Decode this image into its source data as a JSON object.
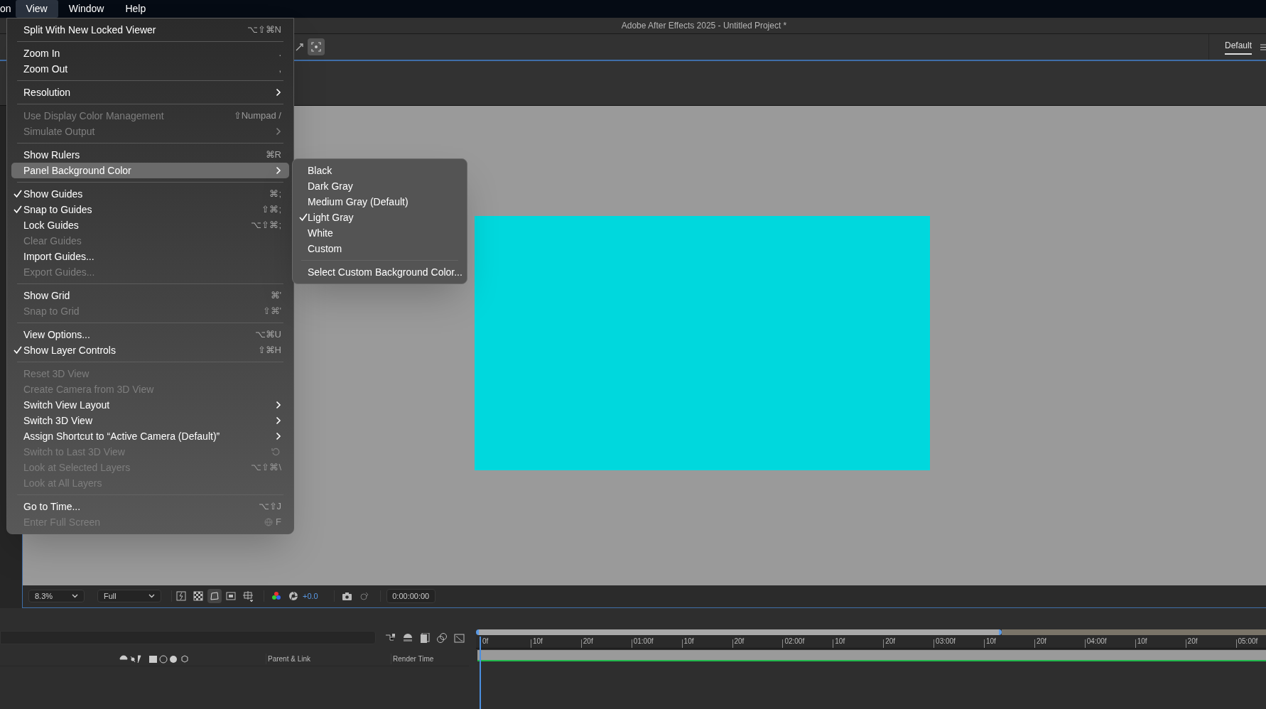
{
  "menu_bar": [
    {
      "label": "on",
      "selected": false
    },
    {
      "label": "View",
      "selected": true
    },
    {
      "label": "Window",
      "selected": false
    },
    {
      "label": "Help",
      "selected": false
    }
  ],
  "window": {
    "title": "Adobe After Effects 2025 - Untitled Project *"
  },
  "workspace": {
    "label": "Default",
    "selected": true
  },
  "view_menu": {
    "groups": [
      [
        {
          "label": "Split With New Locked Viewer",
          "shortcut": "⌥⇧⌘N",
          "checked": false,
          "disabled": false,
          "submenu": false,
          "selected": false
        }
      ],
      [
        {
          "label": "Zoom In",
          "shortcut": ".",
          "checked": false,
          "disabled": false,
          "submenu": false,
          "selected": false
        },
        {
          "label": "Zoom Out",
          "shortcut": ",",
          "checked": false,
          "disabled": false,
          "submenu": false,
          "selected": false
        }
      ],
      [
        {
          "label": "Resolution",
          "checked": false,
          "disabled": false,
          "submenu": true,
          "selected": false
        }
      ],
      [
        {
          "label": "Use Display Color Management",
          "shortcut": "⇧Numpad /",
          "checked": false,
          "disabled": true,
          "submenu": false,
          "selected": false
        },
        {
          "label": "Simulate Output",
          "checked": false,
          "disabled": true,
          "submenu": true,
          "selected": false
        }
      ],
      [
        {
          "label": "Show Rulers",
          "shortcut": "⌘R",
          "checked": false,
          "disabled": false,
          "submenu": false,
          "selected": false
        },
        {
          "label": "Panel Background Color",
          "checked": false,
          "disabled": false,
          "submenu": true,
          "selected": true
        }
      ],
      [
        {
          "label": "Show Guides",
          "shortcut": "⌘;",
          "checked": true,
          "disabled": false,
          "submenu": false,
          "selected": false
        },
        {
          "label": "Snap to Guides",
          "shortcut": "⇧⌘;",
          "checked": true,
          "disabled": false,
          "submenu": false,
          "selected": false
        },
        {
          "label": "Lock Guides",
          "shortcut": "⌥⇧⌘;",
          "checked": false,
          "disabled": false,
          "submenu": false,
          "selected": false
        },
        {
          "label": "Clear Guides",
          "checked": false,
          "disabled": true,
          "submenu": false,
          "selected": false
        },
        {
          "label": "Import Guides...",
          "checked": false,
          "disabled": false,
          "submenu": false,
          "selected": false
        },
        {
          "label": "Export Guides...",
          "checked": false,
          "disabled": true,
          "submenu": false,
          "selected": false
        }
      ],
      [
        {
          "label": "Show Grid",
          "shortcut": "⌘'",
          "checked": false,
          "disabled": false,
          "submenu": false,
          "selected": false
        },
        {
          "label": "Snap to Grid",
          "shortcut": "⇧⌘'",
          "checked": false,
          "disabled": true,
          "submenu": false,
          "selected": false
        }
      ],
      [
        {
          "label": "View Options...",
          "shortcut": "⌥⌘U",
          "checked": false,
          "disabled": false,
          "submenu": false,
          "selected": false
        },
        {
          "label": "Show Layer Controls",
          "shortcut": "⇧⌘H",
          "checked": true,
          "disabled": false,
          "submenu": false,
          "selected": false
        }
      ],
      [
        {
          "label": "Reset 3D View",
          "checked": false,
          "disabled": true,
          "submenu": false,
          "selected": false
        },
        {
          "label": "Create Camera from 3D View",
          "checked": false,
          "disabled": true,
          "submenu": false,
          "selected": false
        },
        {
          "label": "Switch View Layout",
          "checked": false,
          "disabled": false,
          "submenu": true,
          "selected": false
        },
        {
          "label": "Switch 3D View",
          "checked": false,
          "disabled": false,
          "submenu": true,
          "selected": false
        },
        {
          "label": "Assign Shortcut to “Active Camera (Default)”",
          "checked": false,
          "disabled": false,
          "submenu": true,
          "selected": false
        },
        {
          "label": "Switch to Last 3D View",
          "reset_icon": true,
          "checked": false,
          "disabled": true,
          "submenu": false,
          "selected": false
        },
        {
          "label": "Look at Selected Layers",
          "shortcut": "⌥⇧⌘\\",
          "checked": false,
          "disabled": true,
          "submenu": false,
          "selected": false
        },
        {
          "label": "Look at All Layers",
          "checked": false,
          "disabled": true,
          "submenu": false,
          "selected": false
        }
      ],
      [
        {
          "label": "Go to Time...",
          "shortcut": "⌥⇧J",
          "checked": false,
          "disabled": false,
          "submenu": false,
          "selected": false
        },
        {
          "label": "Enter Full Screen",
          "shortcut": "F",
          "globe_icon": true,
          "checked": false,
          "disabled": true,
          "submenu": false,
          "selected": false
        }
      ]
    ]
  },
  "background_submenu": {
    "groups": [
      [
        {
          "label": "Black",
          "checked": false
        },
        {
          "label": "Dark Gray",
          "checked": false
        },
        {
          "label": "Medium Gray (Default)",
          "checked": false
        },
        {
          "label": "Light Gray",
          "checked": true
        },
        {
          "label": "White",
          "checked": false
        },
        {
          "label": "Custom",
          "checked": false
        }
      ],
      [
        {
          "label": "Select Custom Background Color...",
          "checked": false
        }
      ]
    ]
  },
  "viewer": {
    "zoom": "8.3%",
    "resolution": "Full",
    "exposure": "+0.0",
    "timecode": "0:00:00:00"
  },
  "timeline": {
    "columns": [
      "Parent & Link",
      "Render Time"
    ],
    "ruler_labels": [
      "0f",
      "10f",
      "20f",
      "01:00f",
      "10f",
      "20f",
      "02:00f",
      "10f",
      "20f",
      "03:00f",
      "10f",
      "20f",
      "04:00f",
      "10f",
      "20f",
      "05:00f"
    ]
  }
}
